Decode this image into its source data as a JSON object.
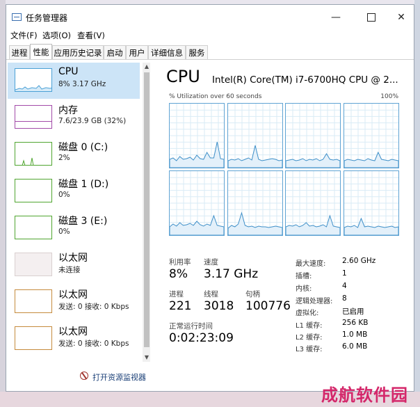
{
  "window": {
    "title": "任务管理器",
    "buttons": {
      "minimize": "—",
      "close": "✕"
    }
  },
  "menu": [
    "文件(F)",
    "选项(O)",
    "查看(V)"
  ],
  "tabs": [
    "进程",
    "性能",
    "应用历史记录",
    "启动",
    "用户",
    "详细信息",
    "服务"
  ],
  "active_tab": "性能",
  "sidebar": {
    "items": [
      {
        "name": "CPU",
        "sub": "8% 3.17 GHz",
        "color": "#4aa0d6"
      },
      {
        "name": "内存",
        "sub": "7.6/23.9 GB (32%)",
        "color": "#a24aa8"
      },
      {
        "name": "磁盘 0 (C:)",
        "sub": "2%",
        "color": "#4fa52f"
      },
      {
        "name": "磁盘 1 (D:)",
        "sub": "0%",
        "color": "#4fa52f"
      },
      {
        "name": "磁盘 3 (E:)",
        "sub": "0%",
        "color": "#4fa52f"
      },
      {
        "name": "以太网",
        "sub": "未连接",
        "color": "#c8a9a0"
      },
      {
        "name": "以太网",
        "sub": "发送: 0 接收: 0 Kbps",
        "color": "#c58a3c"
      },
      {
        "name": "以太网",
        "sub": "发送: 0 接收: 0 Kbps",
        "color": "#c58a3c"
      }
    ],
    "scroll_up": "▲",
    "scroll_down": "▼"
  },
  "main": {
    "title": "CPU",
    "model": "Intel(R) Core(TM) i7-6700HQ CPU @ 2...",
    "util_label": "% Utilization over 60 seconds",
    "util_max": "100%",
    "stats": {
      "utilization_label": "利用率",
      "utilization": "8%",
      "speed_label": "速度",
      "speed": "3.17 GHz",
      "processes_label": "进程",
      "processes": "221",
      "threads_label": "线程",
      "threads": "3018",
      "handles_label": "句柄",
      "handles": "100776",
      "uptime_label": "正常运行时间",
      "uptime": "0:02:23:09"
    },
    "details": [
      {
        "label": "最大速度:",
        "value": "2.60 GHz"
      },
      {
        "label": "插槽:",
        "value": "1"
      },
      {
        "label": "内核:",
        "value": "4"
      },
      {
        "label": "逻辑处理器:",
        "value": "8"
      },
      {
        "label": "虚拟化:",
        "value": "已启用"
      },
      {
        "label": "L1 缓存:",
        "value": "256 KB"
      },
      {
        "label": "L2 缓存:",
        "value": "1.0 MB"
      },
      {
        "label": "L3 缓存:",
        "value": "6.0 MB"
      }
    ]
  },
  "footer": {
    "link": "打开资源监视器"
  },
  "watermark": "成航软件园",
  "colors": {
    "accent": "#4aa0d6",
    "selected_bg": "#cce4f7"
  }
}
